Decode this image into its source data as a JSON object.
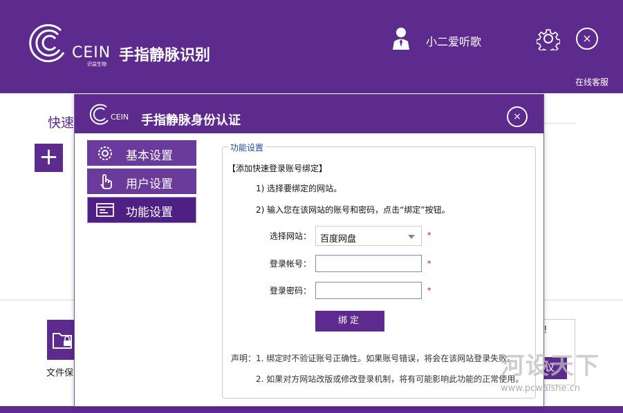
{
  "app": {
    "brand": "CEIN",
    "brand_sub": "识益生物",
    "title": "手指静脉识别",
    "user_name": "小二爱听歌",
    "online_service": "在线客服",
    "close_glyph": "×"
  },
  "background": {
    "quick_label": "快速",
    "add_glyph": "+",
    "file_protect_label": "文件保",
    "excl": "!",
    "purple_btn_text": "议"
  },
  "dialog": {
    "brand": "CEIN",
    "title": "手指静脉身份认证",
    "close_glyph": "×",
    "nav": [
      {
        "label": "基本设置",
        "icon": "gear-icon"
      },
      {
        "label": "用户设置",
        "icon": "hand-icon"
      },
      {
        "label": "功能设置",
        "icon": "window-icon",
        "active": true
      }
    ],
    "panel": {
      "legend": "功能设置",
      "heading": "【添加快速登录账号绑定】",
      "step1": "1) 选择要绑定的网站。",
      "step2": "2) 输入您在该网站的账号和密码，点击“绑定”按钮。",
      "site_label": "选择网站：",
      "site_value": "百度网盘",
      "account_label": "登录帐号：",
      "account_value": "",
      "password_label": "登录密码：",
      "password_value": "",
      "required_mark": "*",
      "bind_label": "绑定",
      "note1": "声明：1. 绑定时不验证账号正确性。如果账号错误，将会在该网站登录失败。",
      "note2": "2. 如果对方网站改版或修改登录机制，将有可能影响此功能的正常使用。"
    }
  },
  "watermark": {
    "text": "河设天下",
    "url": "www.pcwaishe.cn"
  },
  "colors": {
    "brand_purple": "#5d2a8e",
    "nav_active": "#4f2084",
    "legend_blue": "#1a4f9a",
    "required_red": "#dd0000"
  }
}
